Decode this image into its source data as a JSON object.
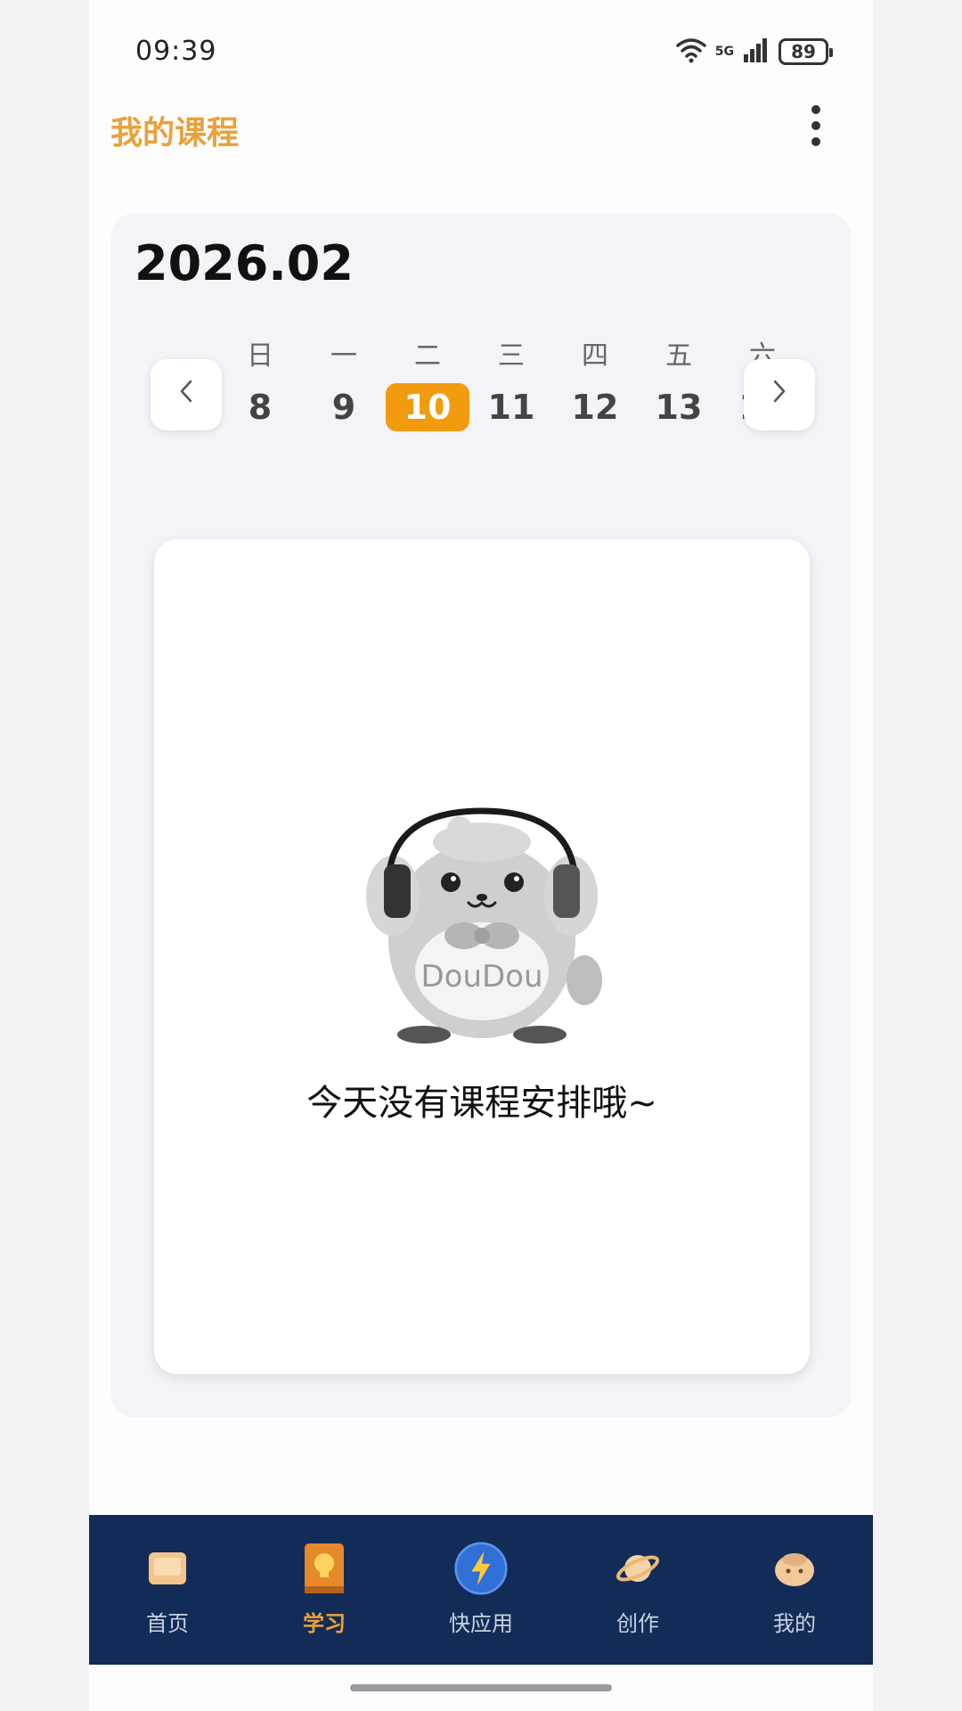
{
  "status_bar": {
    "time": "09:39",
    "signal_label": "5G",
    "battery": "89",
    "icons": [
      "wifi-icon",
      "cellular-signal-icon",
      "battery-icon"
    ]
  },
  "header": {
    "title": "我的课程",
    "menu_icon": "more-vertical-icon"
  },
  "calendar": {
    "month": "2026.02",
    "prev_icon": "chevron-left-icon",
    "next_icon": "chevron-right-icon",
    "days": [
      {
        "weekday": "日",
        "date": "8",
        "selected": false
      },
      {
        "weekday": "一",
        "date": "9",
        "selected": false
      },
      {
        "weekday": "二",
        "date": "10",
        "selected": true
      },
      {
        "weekday": "三",
        "date": "11",
        "selected": false
      },
      {
        "weekday": "四",
        "date": "12",
        "selected": false
      },
      {
        "weekday": "五",
        "date": "13",
        "selected": false
      },
      {
        "weekday": "六",
        "date": "14",
        "selected": false
      }
    ],
    "selected_color": "#f29b0e"
  },
  "empty_state": {
    "mascot_text": "DouDou",
    "message": "今天没有课程安排哦~"
  },
  "bottom_nav": {
    "items": [
      {
        "label": "首页",
        "icon": "home-icon",
        "active": false
      },
      {
        "label": "学习",
        "icon": "study-book-icon",
        "active": true
      },
      {
        "label": "快应用",
        "icon": "quick-app-icon",
        "active": false
      },
      {
        "label": "创作",
        "icon": "planet-icon",
        "active": false
      },
      {
        "label": "我的",
        "icon": "profile-avatar-icon",
        "active": false
      }
    ],
    "background": "#122c57",
    "active_color": "#f3a133"
  },
  "colors": {
    "accent": "#e9a13b"
  }
}
